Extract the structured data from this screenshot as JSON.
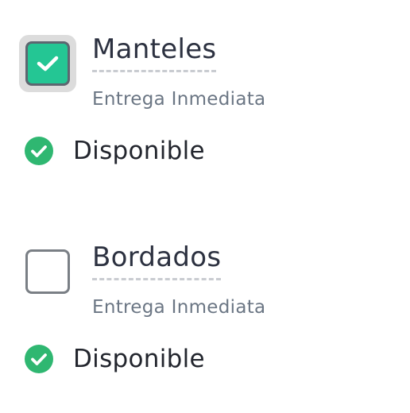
{
  "colors": {
    "check_fill": "#24c694",
    "status_green": "#2fb771",
    "title_text": "#2c3140",
    "subtitle_text": "#6b7684"
  },
  "items": [
    {
      "checked": true,
      "title": "Manteles",
      "subtitle": "Entrega Inmediata",
      "status_icon": "check-circle-icon",
      "status": "Disponible"
    },
    {
      "checked": false,
      "title": "Bordados",
      "subtitle": "Entrega Inmediata",
      "status_icon": "check-circle-icon",
      "status": "Disponible"
    }
  ]
}
